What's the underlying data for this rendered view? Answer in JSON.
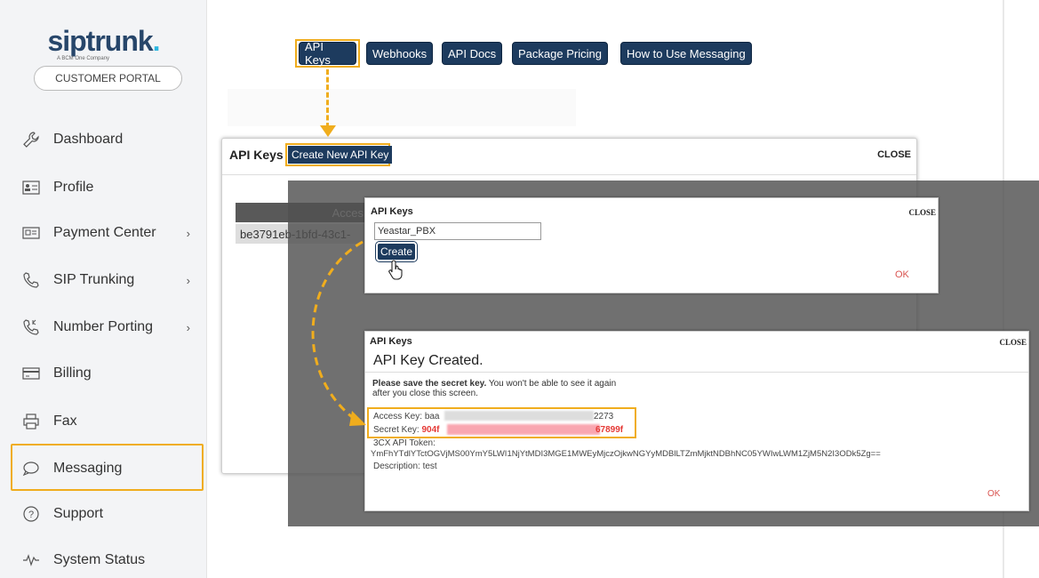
{
  "sidebar": {
    "logo": {
      "text": "siptrunk",
      "dot": ".",
      "sub": "A BCM One Company"
    },
    "portal_button": "CUSTOMER PORTAL",
    "items": [
      {
        "label": "Dashboard",
        "icon": "wrench-icon",
        "has_chevron": false
      },
      {
        "label": "Profile",
        "icon": "id-card-icon",
        "has_chevron": false
      },
      {
        "label": "Payment Center",
        "icon": "payment-icon",
        "has_chevron": true
      },
      {
        "label": "SIP Trunking",
        "icon": "phone-icon",
        "has_chevron": true
      },
      {
        "label": "Number Porting",
        "icon": "phone-forward-icon",
        "has_chevron": true
      },
      {
        "label": "Billing",
        "icon": "card-icon",
        "has_chevron": false
      },
      {
        "label": "Fax",
        "icon": "printer-icon",
        "has_chevron": false
      },
      {
        "label": "Messaging",
        "icon": "chat-icon",
        "has_chevron": false
      },
      {
        "label": "Support",
        "icon": "help-icon",
        "has_chevron": false
      },
      {
        "label": "System Status",
        "icon": "pulse-icon",
        "has_chevron": false
      }
    ],
    "chevron": "›"
  },
  "top_nav": [
    "API Keys",
    "Webhooks",
    "API Docs",
    "Package Pricing",
    "How to Use Messaging"
  ],
  "modal_api_keys": {
    "title": "API Keys",
    "create_button": "Create New API Key",
    "close": "CLOSE",
    "table_header": "Acces",
    "row_value": "be3791eb-1bfd-43c1-"
  },
  "modal_create": {
    "title": "API Keys",
    "close": "CLOSE",
    "input_value": "Yeastar_PBX",
    "create_button": "Create",
    "ok": "OK"
  },
  "modal_created": {
    "title": "API Keys",
    "close": "CLOSE",
    "heading": "API Key Created.",
    "warning_bold": "Please save the secret key.",
    "warning_rest": " You won't be able to see it again",
    "warning_line2": "after you close this screen.",
    "access_label": "Access Key: ",
    "access_start": "baa",
    "access_end": "2273",
    "secret_label": "Secret Key: ",
    "secret_start": "904f",
    "secret_end": "67899f",
    "token_label": "3CX API Token:",
    "token_value": "YmFhYTdlYTctOGVjMS00YmY5LWI1NjYtMDI3MGE1MWEyMjczOjkwNGYyMDBlLTZmMjktNDBhNC05YWIwLWM1ZjM5N2I3ODk5Zg==",
    "description": "Description: test",
    "ok": "OK"
  },
  "colors": {
    "highlight": "#f0ad1d",
    "navy": "#1d3b5e",
    "red": "#e53935"
  }
}
